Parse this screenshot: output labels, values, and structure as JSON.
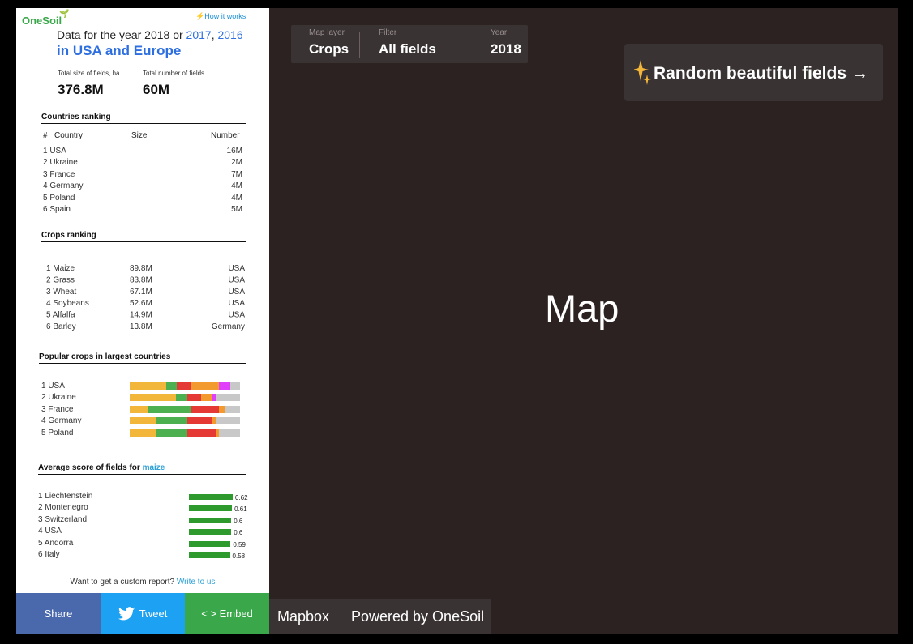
{
  "sidebar": {
    "logo": "OneSoil",
    "how_it_works": "How it works",
    "headline_prefix": "Data for the year 2018 or ",
    "year_2017": "2017",
    "comma": ", ",
    "year_2016": "2016",
    "subheadline": "in USA and Europe",
    "stats": {
      "size_label": "Total size of fields, ha",
      "size_value": "376.8M",
      "count_label": "Total number of fields",
      "count_value": "60M"
    },
    "countries": {
      "title": "Countries ranking",
      "col_num": "#",
      "col_country": "Country",
      "col_size": "Size",
      "col_number": "Number",
      "rows": [
        {
          "rank": "1 USA",
          "number": "16M"
        },
        {
          "rank": "2 Ukraine",
          "number": "2M"
        },
        {
          "rank": "3 France",
          "number": "7M"
        },
        {
          "rank": "4 Germany",
          "number": "4M"
        },
        {
          "rank": "5 Poland",
          "number": "4M"
        },
        {
          "rank": "6 Spain",
          "number": "5M"
        }
      ]
    },
    "crops": {
      "title": "Crops ranking",
      "rows": [
        {
          "name": "1 Maize",
          "size": "89.8M",
          "country": "USA"
        },
        {
          "name": "2 Grass",
          "size": "83.8M",
          "country": "USA"
        },
        {
          "name": "3 Wheat",
          "size": "67.1M",
          "country": "USA"
        },
        {
          "name": "4 Soybeans",
          "size": "52.6M",
          "country": "USA"
        },
        {
          "name": "5 Alfalfa",
          "size": "14.9M",
          "country": "USA"
        },
        {
          "name": "6 Barley",
          "size": "13.8M",
          "country": "Germany"
        }
      ]
    },
    "popular": {
      "title": "Popular crops in largest countries",
      "rows": [
        {
          "name": "1 USA",
          "segments": [
            {
              "f": 0.33,
              "c": "#f2b63a"
            },
            {
              "f": 0.1,
              "c": "#4caf50"
            },
            {
              "f": 0.13,
              "c": "#e53935"
            },
            {
              "f": 0.25,
              "c": "#f29a2e"
            },
            {
              "f": 0.1,
              "c": "#e040fb"
            },
            {
              "f": 0.09,
              "c": "#c8c8c8"
            }
          ]
        },
        {
          "name": "2 Ukraine",
          "segments": [
            {
              "f": 0.42,
              "c": "#f2b63a"
            },
            {
              "f": 0.1,
              "c": "#4caf50"
            },
            {
              "f": 0.13,
              "c": "#e53935"
            },
            {
              "f": 0.09,
              "c": "#f29a2e"
            },
            {
              "f": 0.05,
              "c": "#e040fb"
            },
            {
              "f": 0.21,
              "c": "#c8c8c8"
            }
          ]
        },
        {
          "name": "3 France",
          "segments": [
            {
              "f": 0.17,
              "c": "#f2b63a"
            },
            {
              "f": 0.38,
              "c": "#4caf50"
            },
            {
              "f": 0.26,
              "c": "#e53935"
            },
            {
              "f": 0.06,
              "c": "#f29a2e"
            },
            {
              "f": 0.13,
              "c": "#c8c8c8"
            }
          ]
        },
        {
          "name": "4 Germany",
          "segments": [
            {
              "f": 0.24,
              "c": "#f2b63a"
            },
            {
              "f": 0.28,
              "c": "#4caf50"
            },
            {
              "f": 0.22,
              "c": "#e53935"
            },
            {
              "f": 0.05,
              "c": "#f29a2e"
            },
            {
              "f": 0.21,
              "c": "#c8c8c8"
            }
          ]
        },
        {
          "name": "5 Poland",
          "segments": [
            {
              "f": 0.24,
              "c": "#f2b63a"
            },
            {
              "f": 0.28,
              "c": "#4caf50"
            },
            {
              "f": 0.27,
              "c": "#e53935"
            },
            {
              "f": 0.02,
              "c": "#f29a2e"
            },
            {
              "f": 0.19,
              "c": "#c8c8c8"
            }
          ]
        }
      ]
    },
    "average": {
      "title_prefix": "Average score of fields for ",
      "crop": "maize",
      "rows": [
        {
          "name": "1 Liechtenstein",
          "score": "0.62"
        },
        {
          "name": "2 Montenegro",
          "score": "0.61"
        },
        {
          "name": "3 Switzerland",
          "score": "0.6"
        },
        {
          "name": "4 USA",
          "score": "0.6"
        },
        {
          "name": "5 Andorra",
          "score": "0.59"
        },
        {
          "name": "6 Italy",
          "score": "0.58"
        }
      ]
    },
    "custom_report": "Want to get a custom report? ",
    "write_to_us": "Write to us",
    "share": "Share",
    "tweet": "Tweet",
    "embed": "< > Embed"
  },
  "map": {
    "placeholder": "Map",
    "layer_caption": "Map layer",
    "layer_value": "Crops",
    "filter_caption": "Filter",
    "filter_value": "All fields",
    "year_caption": "Year",
    "year_value": "2018",
    "random_button": "Random beautiful fields",
    "attribution_mapbox": "Mapbox",
    "attribution_onesoil": "Powered by OneSoil"
  },
  "colors": {
    "accent_blue": "#2d6fe0",
    "score_green": "#2e9a2e",
    "map_background": "#2b2221"
  }
}
